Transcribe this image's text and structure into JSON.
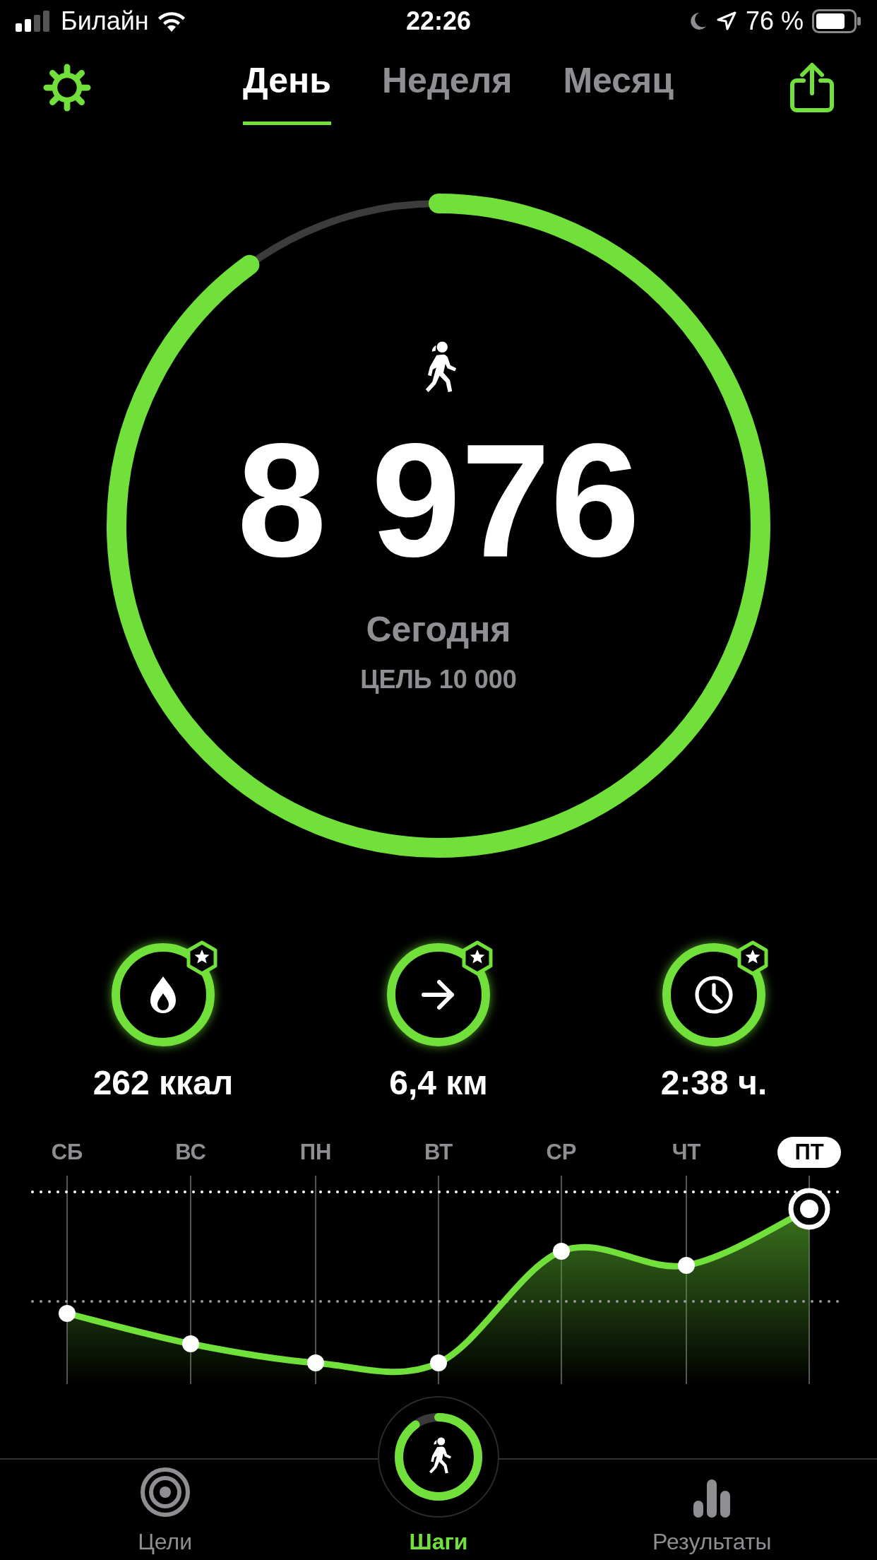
{
  "status_bar": {
    "carrier": "Билайн",
    "time": "22:26",
    "battery": "76 %"
  },
  "tabs": [
    {
      "label": "День",
      "selected": true
    },
    {
      "label": "Неделя",
      "selected": false
    },
    {
      "label": "Месяц",
      "selected": false
    }
  ],
  "goal_ring": {
    "steps": "8 976",
    "period": "Сегодня",
    "goal": "ЦЕЛЬ 10 000"
  },
  "stats": [
    {
      "kind": "calories",
      "value": "262 ккал"
    },
    {
      "kind": "distance",
      "value": "6,4 км"
    },
    {
      "kind": "time",
      "value": "2:38 ч."
    }
  ],
  "days": [
    {
      "label": "СБ",
      "selected": false
    },
    {
      "label": "ВС",
      "selected": false
    },
    {
      "label": "ПН",
      "selected": false
    },
    {
      "label": "ВТ",
      "selected": false
    },
    {
      "label": "СР",
      "selected": false
    },
    {
      "label": "ЧТ",
      "selected": false
    },
    {
      "label": "ПТ",
      "selected": true
    }
  ],
  "nav": [
    {
      "kind": "goals",
      "label": "Цели",
      "selected": false
    },
    {
      "kind": "steps",
      "label": "Шаги",
      "selected": true
    },
    {
      "kind": "results",
      "label": "Результаты",
      "selected": false
    }
  ]
}
